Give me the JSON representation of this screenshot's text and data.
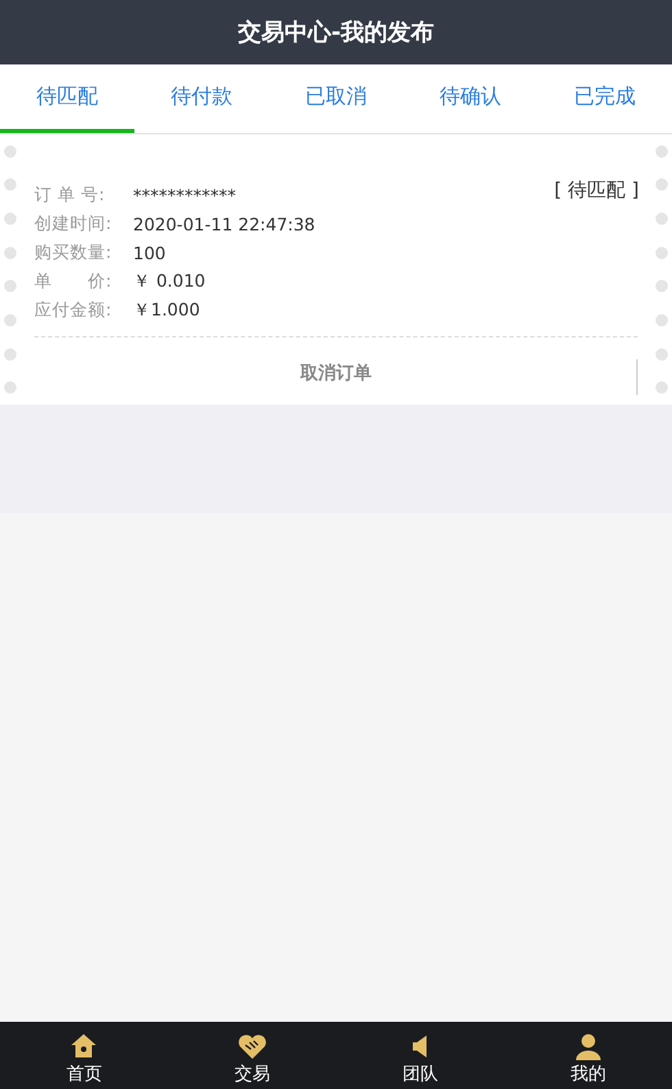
{
  "header": {
    "title": "交易中心-我的发布"
  },
  "tabs": [
    {
      "label": "待匹配",
      "selected": true
    },
    {
      "label": "待付款",
      "selected": false
    },
    {
      "label": "已取消",
      "selected": false
    },
    {
      "label": "待确认",
      "selected": false
    },
    {
      "label": "已完成",
      "selected": false
    }
  ],
  "orders": [
    {
      "status": "[ 待匹配 ]",
      "fields": [
        {
          "label": "订 单 号:",
          "value": "************"
        },
        {
          "label": "创建时间:",
          "value": "2020-01-11 22:47:38"
        },
        {
          "label": "购买数量:",
          "value": "100"
        },
        {
          "label": "单　　价:",
          "value": "￥ 0.010"
        },
        {
          "label": "应付金额:",
          "value": "￥1.000"
        }
      ],
      "action": "取消订单"
    }
  ],
  "nav": [
    {
      "kind": "home",
      "label": "首页"
    },
    {
      "kind": "trade",
      "label": "交易"
    },
    {
      "kind": "team",
      "label": "团队"
    },
    {
      "kind": "mine",
      "label": "我的"
    }
  ]
}
